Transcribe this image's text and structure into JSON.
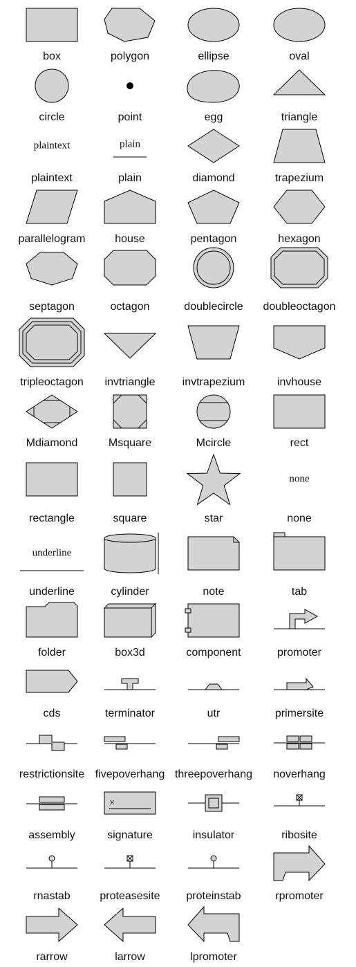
{
  "shapes": [
    {
      "id": "box",
      "label": "box"
    },
    {
      "id": "polygon",
      "label": "polygon"
    },
    {
      "id": "ellipse",
      "label": "ellipse"
    },
    {
      "id": "oval",
      "label": "oval"
    },
    {
      "id": "circle",
      "label": "circle"
    },
    {
      "id": "point",
      "label": "point"
    },
    {
      "id": "egg",
      "label": "egg"
    },
    {
      "id": "triangle",
      "label": "triangle"
    },
    {
      "id": "plaintext",
      "label": "plaintext",
      "inner_text": "plaintext"
    },
    {
      "id": "plain",
      "label": "plain",
      "inner_text": "plain"
    },
    {
      "id": "diamond",
      "label": "diamond"
    },
    {
      "id": "trapezium",
      "label": "trapezium"
    },
    {
      "id": "parallelogram",
      "label": "parallelogram"
    },
    {
      "id": "house",
      "label": "house"
    },
    {
      "id": "pentagon",
      "label": "pentagon"
    },
    {
      "id": "hexagon",
      "label": "hexagon"
    },
    {
      "id": "septagon",
      "label": "septagon"
    },
    {
      "id": "octagon",
      "label": "octagon"
    },
    {
      "id": "doublecircle",
      "label": "doublecircle"
    },
    {
      "id": "doubleoctagon",
      "label": "doubleoctagon"
    },
    {
      "id": "tripleoctagon",
      "label": "tripleoctagon"
    },
    {
      "id": "invtriangle",
      "label": "invtriangle"
    },
    {
      "id": "invtrapezium",
      "label": "invtrapezium"
    },
    {
      "id": "invhouse",
      "label": "invhouse"
    },
    {
      "id": "Mdiamond",
      "label": "Mdiamond"
    },
    {
      "id": "Msquare",
      "label": "Msquare"
    },
    {
      "id": "Mcircle",
      "label": "Mcircle"
    },
    {
      "id": "rect",
      "label": "rect"
    },
    {
      "id": "rectangle",
      "label": "rectangle"
    },
    {
      "id": "square",
      "label": "square"
    },
    {
      "id": "star",
      "label": "star"
    },
    {
      "id": "none",
      "label": "none",
      "inner_text": "none"
    },
    {
      "id": "underline",
      "label": "underline",
      "inner_text": "underline"
    },
    {
      "id": "cylinder",
      "label": "cylinder"
    },
    {
      "id": "note",
      "label": "note"
    },
    {
      "id": "tab",
      "label": "tab"
    },
    {
      "id": "folder",
      "label": "folder"
    },
    {
      "id": "box3d",
      "label": "box3d"
    },
    {
      "id": "component",
      "label": "component"
    },
    {
      "id": "promoter",
      "label": "promoter"
    },
    {
      "id": "cds",
      "label": "cds"
    },
    {
      "id": "terminator",
      "label": "terminator"
    },
    {
      "id": "utr",
      "label": "utr"
    },
    {
      "id": "primersite",
      "label": "primersite"
    },
    {
      "id": "restrictionsite",
      "label": "restrictionsite"
    },
    {
      "id": "fivepoverhang",
      "label": "fivepoverhang"
    },
    {
      "id": "threepoverhang",
      "label": "threepoverhang"
    },
    {
      "id": "noverhang",
      "label": "noverhang"
    },
    {
      "id": "assembly",
      "label": "assembly"
    },
    {
      "id": "signature",
      "label": "signature"
    },
    {
      "id": "insulator",
      "label": "insulator"
    },
    {
      "id": "ribosite",
      "label": "ribosite"
    },
    {
      "id": "rnastab",
      "label": "rnastab"
    },
    {
      "id": "proteasesite",
      "label": "proteasesite"
    },
    {
      "id": "proteinstab",
      "label": "proteinstab"
    },
    {
      "id": "rpromoter",
      "label": "rpromoter"
    },
    {
      "id": "rarrow",
      "label": "rarrow"
    },
    {
      "id": "larrow",
      "label": "larrow"
    },
    {
      "id": "lpromoter",
      "label": "lpromoter"
    }
  ],
  "colors": {
    "fill": "#d3d3d3",
    "stroke": "#000000",
    "background": "#ffffff"
  }
}
